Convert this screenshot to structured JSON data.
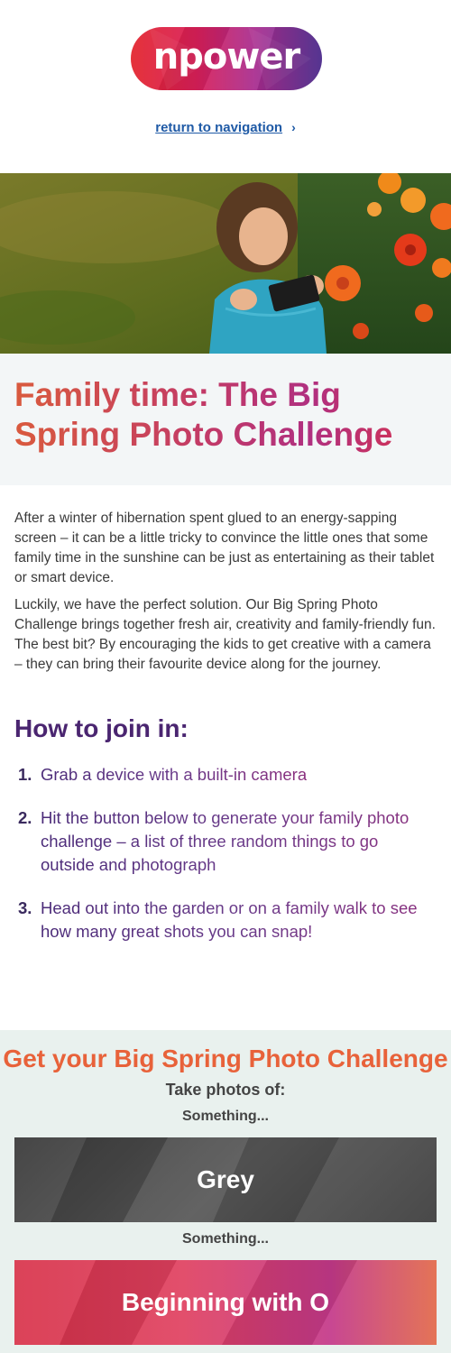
{
  "brand": {
    "logo_text": "npower"
  },
  "nav": {
    "return_label": "return to navigation",
    "chevron": "›"
  },
  "article": {
    "title": "Family time: The Big Spring Photo Challenge",
    "paragraphs": [
      "After a winter of hibernation spent glued to an energy-sapping screen – it can be a little tricky to convince the little ones that some family time in the sunshine can be just as entertaining as their tablet or smart device.",
      "Luckily, we have the perfect solution. Our Big Spring Photo Challenge brings together fresh air, creativity and family-friendly fun. The best bit? By encouraging the kids to get creative with a camera – they can bring their favourite device along for the journey."
    ],
    "how_heading": "How to join in:",
    "steps": [
      {
        "num": "1.",
        "text": "Grab a device with a built-in camera"
      },
      {
        "num": "2.",
        "text": "Hit the button below to generate your family photo challenge – a list of three random things to go outside and photograph"
      },
      {
        "num": "3.",
        "text": "Head out into the garden or on a family walk to see how many great shots you can snap!"
      }
    ]
  },
  "challenge": {
    "title": "Get your Big Spring Photo Challenge",
    "subtitle": "Take photos of:",
    "items": [
      {
        "label": "Something...",
        "value": "Grey"
      },
      {
        "label": "Something...",
        "value": "Beginning with O"
      }
    ]
  },
  "colors": {
    "brand_red": "#e4262e",
    "brand_purple": "#5b3a9c",
    "link_blue": "#1f5aa6",
    "heading_purple": "#4a2570",
    "challenge_orange": "#e8623a",
    "challenge_bg": "#e9f1ee"
  }
}
